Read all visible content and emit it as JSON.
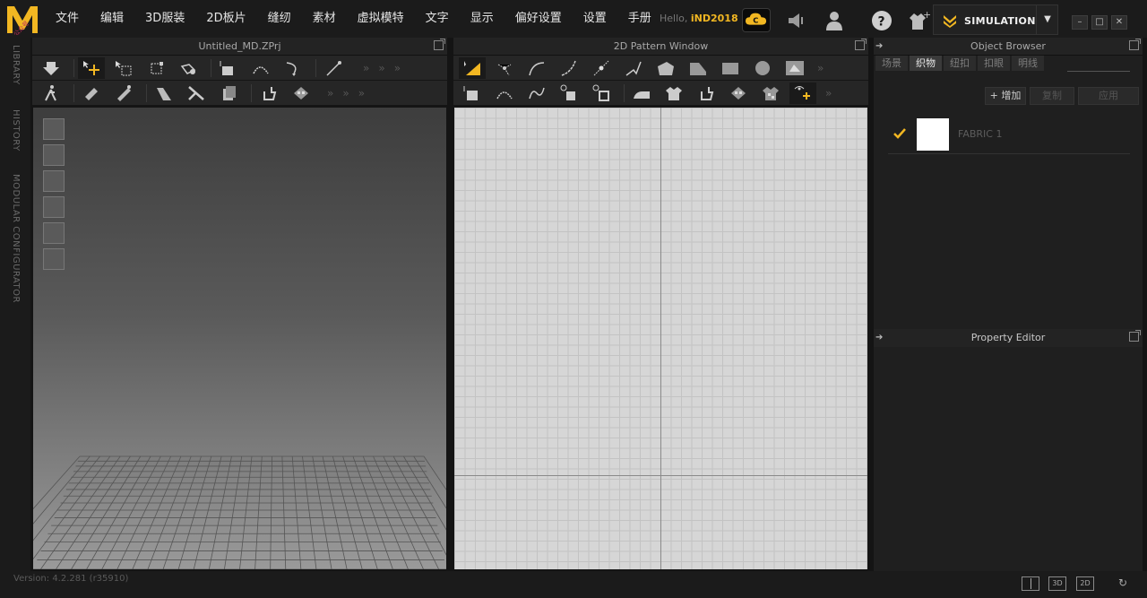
{
  "menubar": {
    "items": [
      "文件",
      "编辑",
      "3D服装",
      "2D板片",
      "缝纫",
      "素材",
      "虚拟模特",
      "文字",
      "显示",
      "偏好设置",
      "设置",
      "手册"
    ],
    "hello_prefix": "Hello,",
    "username": "iND2018",
    "simulation_label": "SIMULATION"
  },
  "left_strip": {
    "tabs": [
      "LIBRARY",
      "HISTORY",
      "MODULAR CONFIGURATOR"
    ]
  },
  "view3d": {
    "title": "Untitled_MD.ZPrj"
  },
  "view2d": {
    "title": "2D Pattern Window"
  },
  "object_browser": {
    "title": "Object Browser",
    "tabs": [
      "场景",
      "织物",
      "纽扣",
      "扣眼",
      "明线"
    ],
    "active_tab": "织物",
    "add_label": "+ 增加",
    "copy_label": "复制",
    "apply_label": "应用",
    "fabrics": [
      {
        "name": "FABRIC 1",
        "color": "#ffffff",
        "checked": true
      }
    ]
  },
  "property_editor": {
    "title": "Property Editor"
  },
  "statusbar": {
    "version": "Version: 4.2.281 (r35910)",
    "view_buttons": [
      "3D",
      "2D"
    ]
  },
  "colors": {
    "accent": "#f2b722",
    "background": "#1b1b1b"
  }
}
